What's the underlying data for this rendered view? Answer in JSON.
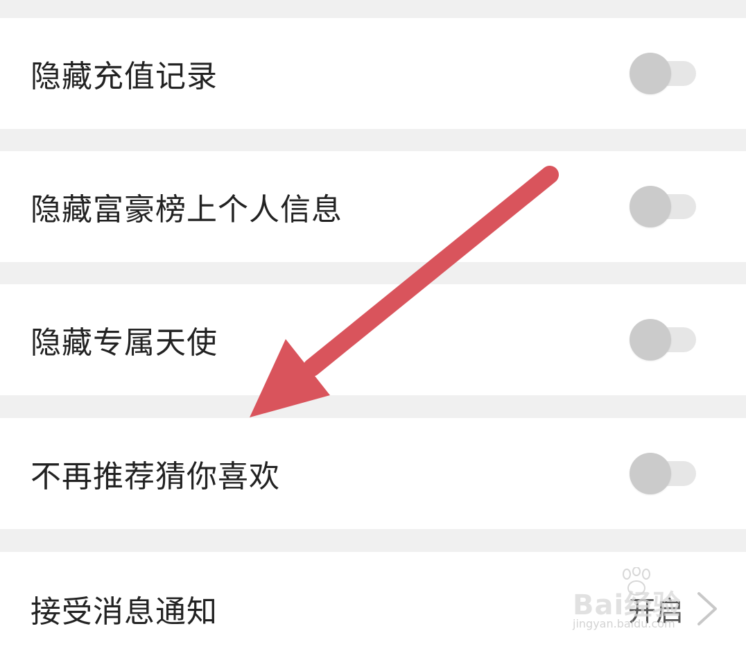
{
  "settings": {
    "items": [
      {
        "label": "隐藏充值记录",
        "control": "toggle",
        "enabled": false
      },
      {
        "label": "隐藏富豪榜上个人信息",
        "control": "toggle",
        "enabled": false
      },
      {
        "label": "隐藏专属天使",
        "control": "toggle",
        "enabled": false
      },
      {
        "label": "不再推荐猜你喜欢",
        "control": "toggle",
        "enabled": false
      },
      {
        "label": "接受消息通知",
        "control": "link",
        "value": "开启"
      }
    ]
  },
  "annotation": {
    "type": "arrow",
    "color": "#d9545c",
    "points_to": "不再推荐猜你喜欢"
  },
  "watermark": {
    "logo_text": "Bai经验",
    "url": "jingyan.baidu.com"
  },
  "colors": {
    "background": "#f0f0f0",
    "row_background": "#ffffff",
    "toggle_knob_off": "#cbcbcb",
    "toggle_track_off": "#e6e6e6"
  }
}
